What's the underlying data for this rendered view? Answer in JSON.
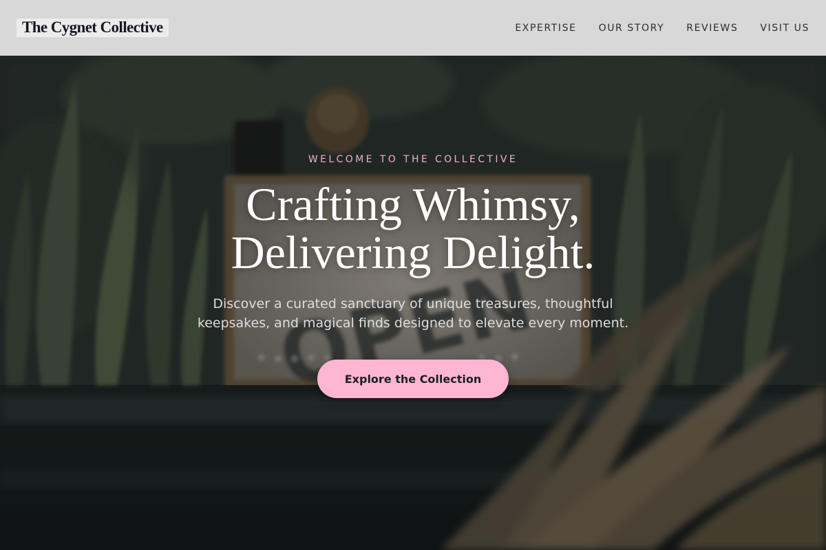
{
  "header": {
    "logo": "The Cygnet Collective",
    "nav": [
      {
        "label": "EXPERTISE"
      },
      {
        "label": "OUR STORY"
      },
      {
        "label": "REVIEWS"
      },
      {
        "label": "VISIT US"
      }
    ]
  },
  "hero": {
    "eyebrow": "WELCOME TO THE COLLECTIVE",
    "headline_line1": "Crafting Whimsy,",
    "headline_line2": "Delivering Delight.",
    "subtext": "Discover a curated sanctuary of unique treasures, thoughtful keepsakes, and magical finds designed to elevate every moment.",
    "cta_label": "Explore the Collection",
    "background_sign_text": "OPEN"
  },
  "colors": {
    "accent_pink": "#ffb6d2",
    "eyebrow_pink": "#f2b0c9",
    "header_bg": "#dedede",
    "text_dark": "#151821"
  }
}
